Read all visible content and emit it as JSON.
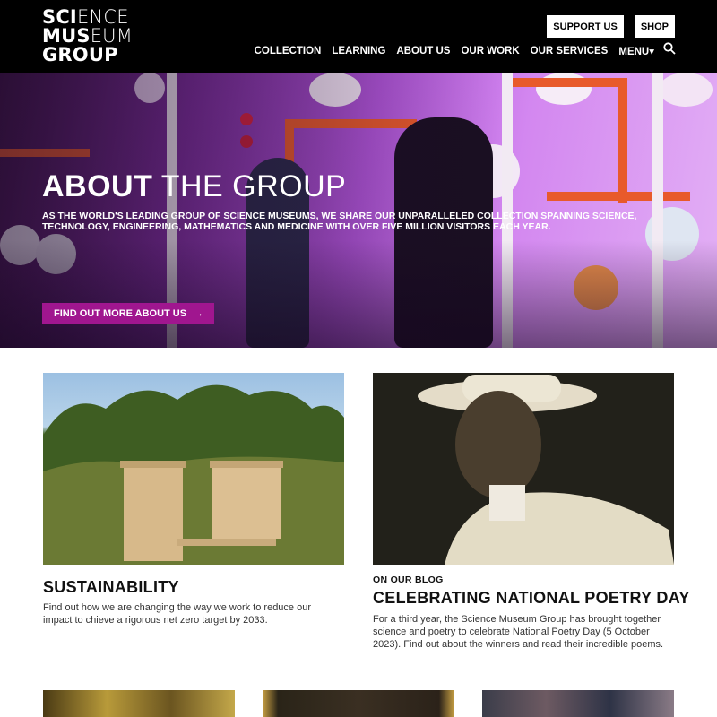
{
  "header": {
    "logo": {
      "line1_bold": "SCI",
      "line1_light": "ENCE",
      "line2_bold": "MUS",
      "line2_light": "EUM",
      "line3_bold": "GROUP"
    },
    "buttons": {
      "support": "SUPPORT US",
      "shop": "SHOP"
    },
    "nav": [
      {
        "label": "COLLECTION"
      },
      {
        "label": "LEARNING"
      },
      {
        "label": "ABOUT US"
      },
      {
        "label": "OUR WORK"
      },
      {
        "label": "OUR SERVICES"
      },
      {
        "label": "MENU▾"
      }
    ],
    "search_icon": "search-icon"
  },
  "hero": {
    "title_bold": "ABOUT",
    "title_light": " THE GROUP",
    "text": "AS THE WORLD'S LEADING GROUP OF SCIENCE MUSEUMS, WE SHARE OUR UNPARALLELED COLLECTION SPANNING SCIENCE, TECHNOLOGY, ENGINEERING, MATHEMATICS AND MEDICINE WITH OVER FIVE MILLION VISITORS EACH YEAR.",
    "cta": "FIND OUT MORE ABOUT US",
    "cta_icon": "arrow-right-icon",
    "accent": "#a0168f"
  },
  "cards": [
    {
      "title": "SUSTAINABILITY",
      "text": "Find out how we are changing the way we work to reduce our impact to chieve a rigorous net zero target by 2033."
    },
    {
      "eyebrow": "ON OUR BLOG",
      "title": "CELEBRATING NATIONAL POETRY DAY",
      "text": "For a third year, the Science Museum Group has brought together science and poetry to celebrate National Poetry Day (5 October 2023). Find out about the winners and read their incredible poems."
    }
  ]
}
